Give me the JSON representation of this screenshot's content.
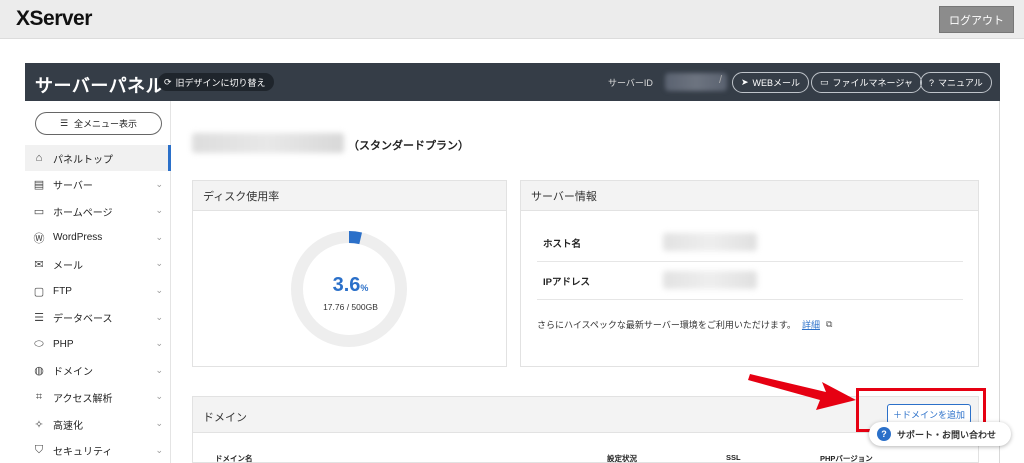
{
  "header": {
    "logo": "XServer",
    "logout_label": "ログアウト"
  },
  "panel": {
    "title": "サーバーパネル",
    "old_design_label": "旧デザインに切り替え",
    "server_id_label": "サーバーID",
    "links": [
      {
        "label": "WEBメール",
        "icon": "paper-plane-icon"
      },
      {
        "label": "ファイルマネージャ",
        "icon": "folder-icon"
      },
      {
        "label": "マニュアル",
        "icon": "question-icon"
      }
    ]
  },
  "sidebar": {
    "menu_button": "全メニュー表示",
    "items": [
      {
        "label": "パネルトップ",
        "icon": "home-icon",
        "active": true
      },
      {
        "label": "サーバー",
        "icon": "server-icon"
      },
      {
        "label": "ホームページ",
        "icon": "browser-icon"
      },
      {
        "label": "WordPress",
        "icon": "wordpress-icon"
      },
      {
        "label": "メール",
        "icon": "mail-icon"
      },
      {
        "label": "FTP",
        "icon": "monitor-icon"
      },
      {
        "label": "データベース",
        "icon": "database-icon"
      },
      {
        "label": "PHP",
        "icon": "php-icon"
      },
      {
        "label": "ドメイン",
        "icon": "globe-icon"
      },
      {
        "label": "アクセス解析",
        "icon": "chart-icon"
      },
      {
        "label": "高速化",
        "icon": "rocket-icon"
      },
      {
        "label": "セキュリティ",
        "icon": "shield-icon"
      }
    ]
  },
  "main": {
    "plan_label": "（スタンダードプラン）",
    "disk": {
      "title": "ディスク使用率",
      "percent": "3.6",
      "percent_unit": "%",
      "usage_text": "17.76 / 500GB",
      "fraction": 0.036
    },
    "server_info": {
      "title": "サーバー情報",
      "rows": [
        {
          "label": "ホスト名"
        },
        {
          "label": "IPアドレス"
        }
      ],
      "spec_text": "さらにハイスペックな最新サーバー環境をご利用いただけます。",
      "detail_link": "詳細"
    },
    "domain": {
      "title": "ドメイン",
      "add_button": "＋ドメインを追加",
      "columns": [
        "ドメイン名",
        "設定状況",
        "SSL",
        "PHPバージョン"
      ]
    }
  },
  "support": {
    "label": "サポート・お問い合わせ"
  },
  "colors": {
    "accent": "#2b70c9",
    "header_bg": "#353d47",
    "highlight": "#e60012"
  }
}
